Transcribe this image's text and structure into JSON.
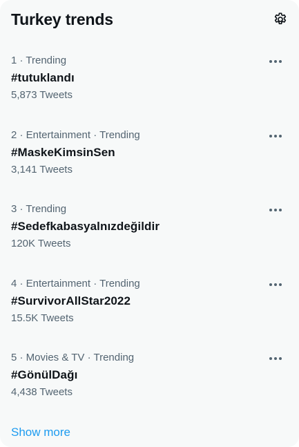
{
  "header": {
    "title": "Turkey trends",
    "settings_icon": "gear-icon"
  },
  "trends": [
    {
      "meta": "1 · Trending",
      "name": "#tutuklandı",
      "count": "5,873 Tweets"
    },
    {
      "meta": "2 · Entertainment · Trending",
      "name": "#MaskeKimsinSen",
      "count": "3,141 Tweets"
    },
    {
      "meta": "3 · Trending",
      "name": "#Sedefkabasyalnızdeğildir",
      "count": "120K Tweets"
    },
    {
      "meta": "4 · Entertainment · Trending",
      "name": "#SurvivorAllStar2022",
      "count": "15.5K Tweets"
    },
    {
      "meta": "5 · Movies & TV · Trending",
      "name": "#GönülDağı",
      "count": "4,438 Tweets"
    }
  ],
  "footer": {
    "show_more": "Show more"
  },
  "colors": {
    "accent": "#1d9bf0",
    "secondary_text": "#536471",
    "panel_bg": "#f7f9f9"
  }
}
